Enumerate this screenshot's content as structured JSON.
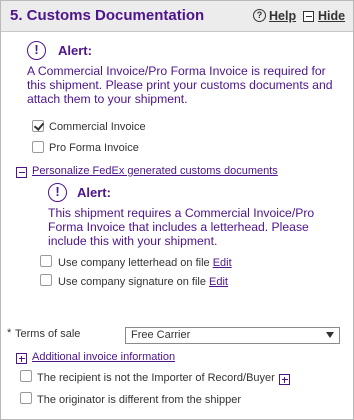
{
  "header": {
    "title": "5. Customs Documentation",
    "help_label": "Help",
    "hide_label": "Hide"
  },
  "alert1": {
    "title": "Alert:",
    "lines": [
      "A Commercial Invoice/Pro Forma Invoice is required for",
      "this shipment. Please print your customs documents and",
      "attach them to your shipment."
    ]
  },
  "documents": {
    "commercial_invoice": {
      "label": "Commercial Invoice",
      "checked": true
    },
    "pro_forma_invoice": {
      "label": "Pro Forma Invoice",
      "checked": false
    }
  },
  "personalize": {
    "link_label": "Personalize FedEx generated customs documents"
  },
  "alert2": {
    "title": "Alert:",
    "lines": [
      "This shipment requires a Commercial Invoice/Pro",
      "Forma Invoice that includes a letterhead. Please",
      "include this with your shipment."
    ]
  },
  "options": {
    "letterhead": {
      "label": "Use company letterhead on file",
      "edit_label": "Edit",
      "checked": false
    },
    "signature": {
      "label": "Use company signature on file",
      "edit_label": "Edit",
      "checked": false
    }
  },
  "terms": {
    "required_mark": "*",
    "label": "Terms of sale",
    "selected": "Free Carrier"
  },
  "additional": {
    "link_label": "Additional invoice information"
  },
  "importer": {
    "label": "The recipient is not the Importer of Record/Buyer",
    "checked": false
  },
  "originator": {
    "label": "The originator is different from the shipper",
    "checked": false
  },
  "colors": {
    "brand_purple": "#4d148c",
    "header_bg": "#ececec",
    "text": "#333333"
  }
}
